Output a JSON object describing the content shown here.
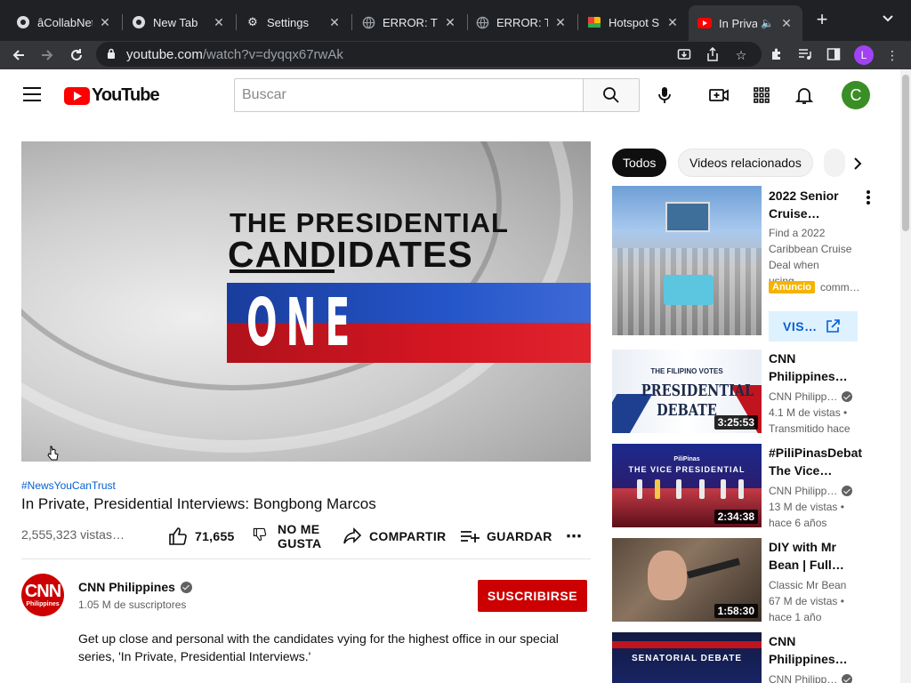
{
  "browser": {
    "tabs": [
      {
        "title": "âCollabNet",
        "favicon": "chrome-icon"
      },
      {
        "title": "New Tab",
        "favicon": "chrome-icon"
      },
      {
        "title": "Settings",
        "favicon": "gear-icon"
      },
      {
        "title": "ERROR: Th",
        "favicon": "globe-icon"
      },
      {
        "title": "ERROR: Th",
        "favicon": "globe-icon"
      },
      {
        "title": "Hotspot Sh",
        "favicon": "hotspot-icon"
      },
      {
        "title": "In Priva",
        "favicon": "youtube-icon",
        "active": true
      }
    ],
    "url_host": "youtube.com",
    "url_path": "/watch?v=dyqqx67rwAk",
    "profile_initial": "L"
  },
  "header": {
    "logo_text": "YouTube",
    "search_placeholder": "Buscar",
    "avatar_initial": "C"
  },
  "video": {
    "overlay_line1": "THE PRESIDENTIAL",
    "overlay_line2": "CANDIDATES",
    "overlay_line3": "ONE",
    "hashtag": "#NewsYouCanTrust",
    "title": "In Private, Presidential Interviews: Bongbong Marcos",
    "views": "2,555,323 vistas…",
    "likes": "71,655",
    "dislike_line1": "NO ME",
    "dislike_line2": "GUSTA",
    "share": "COMPARTIR",
    "save": "GUARDAR"
  },
  "channel": {
    "name": "CNN Philippines",
    "avatar_text": "CNN",
    "avatar_subtext": "Philippines",
    "subscribers": "1.05 M de suscriptores",
    "subscribe_label": "SUSCRIBIRSE",
    "description_line1": "Get up close and personal with the candidates vying for the highest office in our special",
    "description_line2": "series, 'In Private, Presidential Interviews.'"
  },
  "sidebar": {
    "chips": [
      "Todos",
      "Videos relacionados"
    ],
    "ad": {
      "title_line1": "2022 Senior",
      "title_line2": "Cruise…",
      "desc_line1": "Find a 2022",
      "desc_line2": "Caribbean Cruise",
      "desc_line3": "Deal when using…",
      "badge": "Anuncio",
      "domain": "comm…",
      "visit_label": "VIS…"
    },
    "related": [
      {
        "thumb_line1": "THE FILIPINO VOTES",
        "thumb_line2": "PRESIDENTIAL",
        "thumb_line3": "DEBATE",
        "title_line1": "CNN",
        "title_line2": "Philippines…",
        "channel": "CNN Philipp…",
        "views": "4.1 M de vistas •",
        "age": "Transmitido hace",
        "duration": "3:25:53"
      },
      {
        "thumb_line1": "PiliPinas",
        "thumb_line2": "THE VICE PRESIDENTIAL",
        "title_line1": "#PiliPinasDebat",
        "title_line2": "The Vice…",
        "channel": "CNN Philipp…",
        "views": "13 M de vistas •",
        "age": "hace 6 años",
        "duration": "2:34:38"
      },
      {
        "title_line1": "DIY with Mr",
        "title_line2": "Bean | Full…",
        "channel": "Classic Mr Bean",
        "views": "67 M de vistas •",
        "age": "hace 1 año",
        "duration": "1:58:30"
      },
      {
        "thumb_line1": "SENATORIAL DEBATE",
        "title_line1": "CNN",
        "title_line2": "Philippines…",
        "channel": "CNN Philipp…"
      }
    ]
  }
}
